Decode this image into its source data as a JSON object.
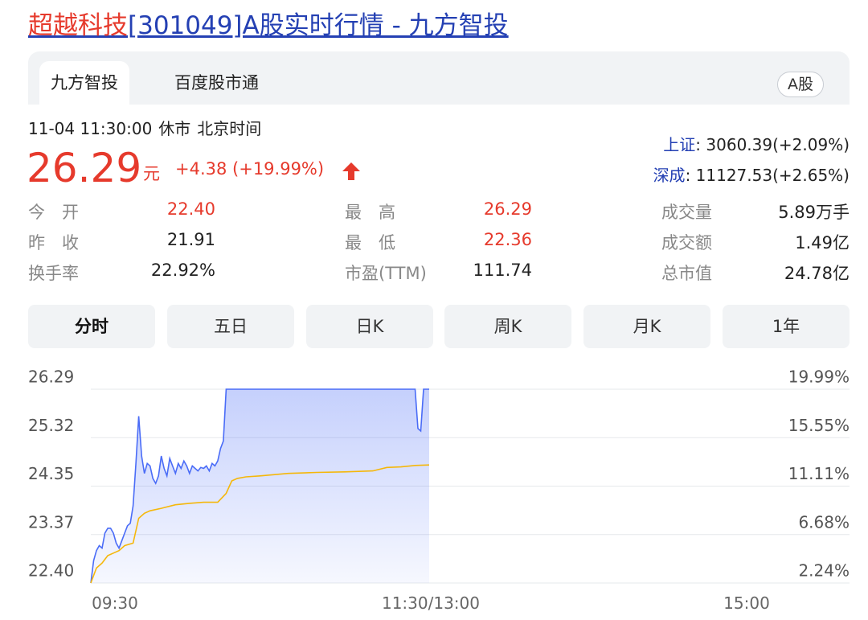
{
  "title": {
    "stock_name": "超越科技",
    "rest": "[301049]A股实时行情 - 九方智投"
  },
  "tabs": {
    "active": "九方智投",
    "other": "百度股市通",
    "market_badge": "A股"
  },
  "status": {
    "time": "11-04 11:30:00",
    "state": "休市",
    "zone": "北京时间"
  },
  "quote": {
    "price": "26.29",
    "unit": "元",
    "change": "+4.38 (+19.99%)"
  },
  "indices": [
    {
      "name": "上证",
      "value": ": 3060.39(+2.09%)"
    },
    {
      "name": "深成",
      "value": ": 11127.53(+2.65%)"
    }
  ],
  "stats": {
    "open": {
      "label": "今　开",
      "value": "22.40"
    },
    "prev_close": {
      "label": "昨　收",
      "value": "21.91"
    },
    "turnover_rate": {
      "label": "换手率",
      "value": "22.92%"
    },
    "high": {
      "label": "最　高",
      "value": "26.29"
    },
    "low": {
      "label": "最　低",
      "value": "22.36"
    },
    "pe": {
      "label": "市盈(TTM)",
      "value": "111.74"
    },
    "volume": {
      "label": "成交量",
      "value": "5.89万手"
    },
    "amount": {
      "label": "成交额",
      "value": "1.49亿"
    },
    "market_cap": {
      "label": "总市值",
      "value": "24.78亿"
    }
  },
  "chart_tabs": [
    "分时",
    "五日",
    "日K",
    "周K",
    "月K",
    "1年"
  ],
  "colors": {
    "up": "#e63a2c",
    "link": "#2440b3",
    "price_line": "#4a6cf7",
    "avg_line": "#f5b70a"
  },
  "chart_data": {
    "type": "line",
    "y_labels_left": [
      "26.29",
      "25.32",
      "24.35",
      "23.37",
      "22.40"
    ],
    "y_labels_right": [
      "19.99%",
      "15.55%",
      "11.11%",
      "6.68%",
      "2.24%"
    ],
    "x_labels": [
      "09:30",
      "11:30/13:00",
      "15:00"
    ],
    "ylim": [
      22.4,
      26.29
    ],
    "session_minutes": 240,
    "series": [
      {
        "values": [
          [
            0,
            22.4
          ],
          [
            1,
            22.85
          ],
          [
            2,
            23.05
          ],
          [
            3,
            23.15
          ],
          [
            4,
            23.1
          ],
          [
            5,
            23.4
          ],
          [
            6,
            23.5
          ],
          [
            7,
            23.5
          ],
          [
            8,
            23.4
          ],
          [
            9,
            23.2
          ],
          [
            10,
            23.1
          ],
          [
            11,
            23.25
          ],
          [
            12,
            23.4
          ],
          [
            13,
            23.55
          ],
          [
            14,
            23.6
          ],
          [
            15,
            23.95
          ],
          [
            16,
            24.8
          ],
          [
            17,
            25.75
          ],
          [
            18,
            24.95
          ],
          [
            19,
            24.6
          ],
          [
            20,
            24.8
          ],
          [
            21,
            24.75
          ],
          [
            22,
            24.5
          ],
          [
            23,
            24.4
          ],
          [
            24,
            24.55
          ],
          [
            25,
            24.95
          ],
          [
            26,
            24.7
          ],
          [
            27,
            24.55
          ],
          [
            28,
            24.9
          ],
          [
            29,
            24.75
          ],
          [
            30,
            24.6
          ],
          [
            31,
            24.8
          ],
          [
            32,
            24.7
          ],
          [
            33,
            24.85
          ],
          [
            34,
            24.75
          ],
          [
            35,
            24.6
          ],
          [
            36,
            24.75
          ],
          [
            37,
            24.7
          ],
          [
            38,
            24.65
          ],
          [
            39,
            24.72
          ],
          [
            40,
            24.7
          ],
          [
            41,
            24.75
          ],
          [
            42,
            24.65
          ],
          [
            43,
            24.8
          ],
          [
            44,
            24.75
          ],
          [
            45,
            24.85
          ],
          [
            46,
            25.1
          ],
          [
            47,
            25.25
          ],
          [
            48,
            26.29
          ],
          [
            60,
            26.29
          ],
          [
            70,
            26.29
          ],
          [
            80,
            26.29
          ],
          [
            90,
            26.29
          ],
          [
            100,
            26.29
          ],
          [
            110,
            26.29
          ],
          [
            115,
            26.29
          ],
          [
            116,
            25.5
          ],
          [
            117,
            25.45
          ],
          [
            118,
            26.29
          ],
          [
            120,
            26.29
          ]
        ]
      },
      {
        "values": [
          [
            0,
            22.4
          ],
          [
            2,
            22.7
          ],
          [
            4,
            22.8
          ],
          [
            6,
            22.95
          ],
          [
            8,
            23.0
          ],
          [
            10,
            23.05
          ],
          [
            12,
            23.15
          ],
          [
            15,
            23.2
          ],
          [
            17,
            23.7
          ],
          [
            19,
            23.8
          ],
          [
            21,
            23.85
          ],
          [
            25,
            23.9
          ],
          [
            30,
            23.97
          ],
          [
            35,
            24.0
          ],
          [
            40,
            24.02
          ],
          [
            45,
            24.02
          ],
          [
            48,
            24.2
          ],
          [
            50,
            24.45
          ],
          [
            52,
            24.5
          ],
          [
            55,
            24.53
          ],
          [
            60,
            24.55
          ],
          [
            70,
            24.6
          ],
          [
            80,
            24.62
          ],
          [
            90,
            24.63
          ],
          [
            100,
            24.65
          ],
          [
            105,
            24.72
          ],
          [
            110,
            24.73
          ],
          [
            115,
            24.76
          ],
          [
            120,
            24.77
          ]
        ]
      }
    ]
  }
}
